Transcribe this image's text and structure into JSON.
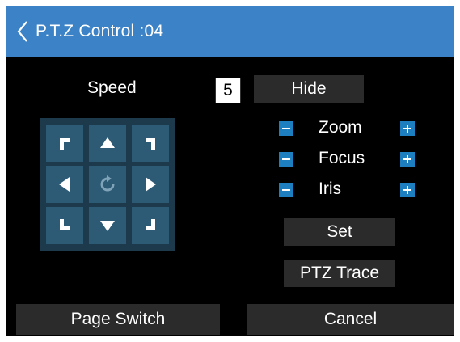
{
  "header": {
    "title": "P.T.Z Control :04",
    "back_icon": "chevron-left-icon"
  },
  "speed": {
    "label": "Speed",
    "value": "5"
  },
  "buttons": {
    "hide": "Hide",
    "set": "Set",
    "ptz_trace": "PTZ Trace",
    "page_switch": "Page Switch",
    "cancel": "Cancel"
  },
  "controls": [
    {
      "label": "Zoom",
      "minus_icon": "minus-icon",
      "plus_icon": "plus-icon"
    },
    {
      "label": "Focus",
      "minus_icon": "minus-icon",
      "plus_icon": "plus-icon"
    },
    {
      "label": "Iris",
      "minus_icon": "minus-icon",
      "plus_icon": "plus-icon"
    }
  ],
  "direction_pad": {
    "icons": [
      "arrow-up-left-icon",
      "arrow-up-icon",
      "arrow-up-right-icon",
      "arrow-left-icon",
      "auto-rotate-icon",
      "arrow-right-icon",
      "arrow-down-left-icon",
      "arrow-down-icon",
      "arrow-down-right-icon"
    ]
  },
  "colors": {
    "title_bar": "#3c82c6",
    "background": "#000000",
    "pad_cell": "#2d5a74",
    "button_bg": "#2b2b2b",
    "accent_square": "#1e7fc0"
  }
}
